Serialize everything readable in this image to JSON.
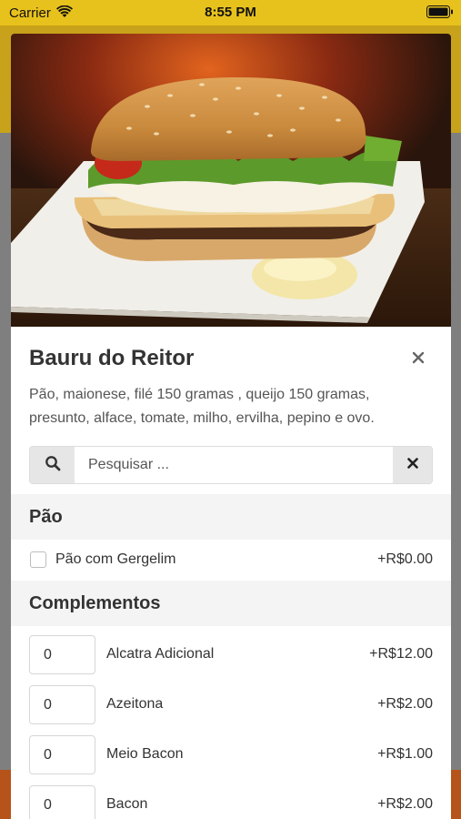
{
  "status_bar": {
    "carrier": "Carrier",
    "time": "8:55 PM"
  },
  "product": {
    "title": "Bauru do Reitor",
    "description": "Pão, maionese, filé 150 gramas , queijo 150 gramas, presunto, alface, tomate, milho, ervilha, pepino e ovo.",
    "image_icon": "burger-photo"
  },
  "search": {
    "placeholder": "Pesquisar ..."
  },
  "sections": [
    {
      "title": "Pão",
      "options": [
        {
          "label": "Pão com Gergelim",
          "price": "+R$0.00",
          "checked": false
        }
      ]
    },
    {
      "title": "Complementos",
      "items": [
        {
          "qty": "0",
          "label": "Alcatra Adicional",
          "price": "+R$12.00"
        },
        {
          "qty": "0",
          "label": "Azeitona",
          "price": "+R$2.00"
        },
        {
          "qty": "0",
          "label": "Meio Bacon",
          "price": "+R$1.00"
        },
        {
          "qty": "0",
          "label": "Bacon",
          "price": "+R$2.00"
        }
      ]
    }
  ],
  "colors": {
    "status_bar": "#e8c21c",
    "overlay": "#7f7f7f",
    "section_bg": "#f4f4f4",
    "button_bg": "#e6e6e6"
  }
}
